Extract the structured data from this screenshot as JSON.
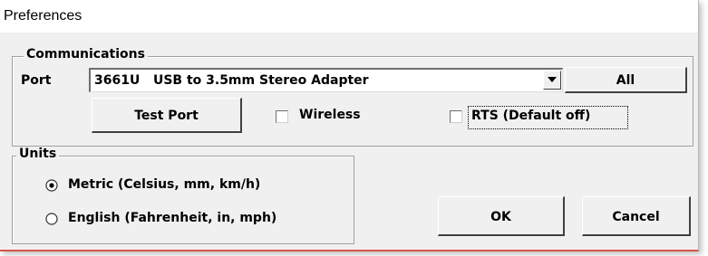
{
  "window": {
    "title": "Preferences"
  },
  "communications": {
    "group_label": "Communications",
    "port_label": "Port",
    "port_selected": "3661U   USB to 3.5mm Stereo Adapter",
    "all_button": "All",
    "test_port_button": "Test Port",
    "wireless": {
      "label": "Wireless",
      "checked": false
    },
    "rts": {
      "label": "RTS (Default off)",
      "checked": false
    }
  },
  "units": {
    "group_label": "Units",
    "options": [
      {
        "label": "Metric (Celsius, mm, km/h)",
        "selected": true
      },
      {
        "label": "English (Fahrenheit, in, mph)",
        "selected": false
      }
    ]
  },
  "buttons": {
    "ok": "OK",
    "cancel": "Cancel"
  }
}
